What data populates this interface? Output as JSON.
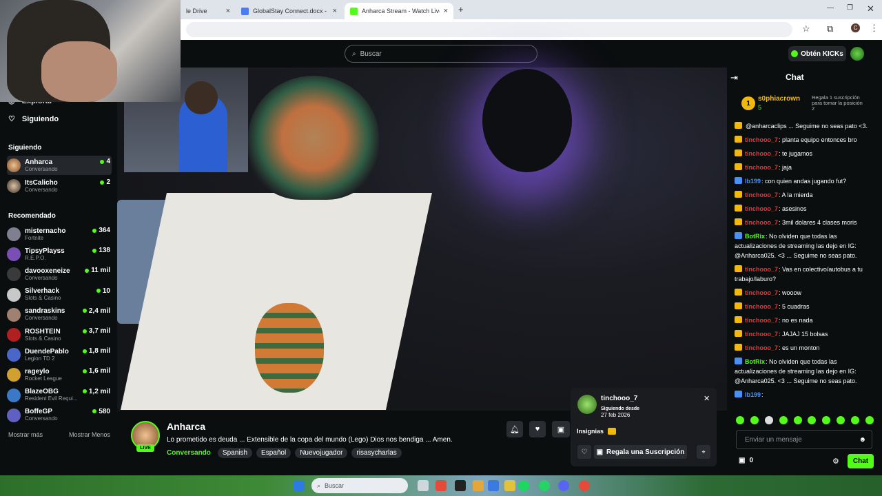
{
  "browser": {
    "tabs": [
      {
        "label": "le Drive"
      },
      {
        "label": "GlobalStay Connect.docx - Doc"
      },
      {
        "label": "Anharca Stream - Watch Live o"
      }
    ]
  },
  "kick": {
    "search_placeholder": "Buscar",
    "get_kicks": "Obtén KICKs"
  },
  "sidebar": {
    "nav": [
      {
        "label": "Explorar"
      },
      {
        "label": "Siguiendo"
      }
    ],
    "following_title": "Siguiendo",
    "following": [
      {
        "name": "Anharca",
        "sub": "Conversando",
        "viewers": "4"
      },
      {
        "name": "ItsCalicho",
        "sub": "Conversando",
        "viewers": "2"
      }
    ],
    "recommended_title": "Recomendado",
    "recommended": [
      {
        "name": "misternacho",
        "sub": "Fortnite",
        "viewers": "364"
      },
      {
        "name": "TipsyPlayss",
        "sub": "R.E.P.O.",
        "viewers": "138"
      },
      {
        "name": "davooxeneize",
        "sub": "Conversando",
        "viewers": "11 mil"
      },
      {
        "name": "Silverhack",
        "sub": "Slots & Casino",
        "viewers": "10"
      },
      {
        "name": "sandraskins",
        "sub": "Conversando",
        "viewers": "2,4 mil"
      },
      {
        "name": "ROSHTEIN",
        "sub": "Slots & Casino",
        "viewers": "3,7 mil"
      },
      {
        "name": "DuendePablo",
        "sub": "Legion TD 2",
        "viewers": "1,8 mil"
      },
      {
        "name": "rageylo",
        "sub": "Rocket League",
        "viewers": "1,6 mil"
      },
      {
        "name": "BlazeOBG",
        "sub": "Resident Evil Requi...",
        "viewers": "1,2 mil"
      },
      {
        "name": "BoffeGP",
        "sub": "Conversando",
        "viewers": "580"
      }
    ],
    "show_more": "Mostrar más",
    "show_less": "Mostrar Menos"
  },
  "stream": {
    "name": "Anharca",
    "live": "LIVE",
    "title": "Lo prometido es deuda ... Extensible de la copa del mundo (Lego) Dios nos bendiga ... Amen.",
    "category": "Conversando",
    "tags": [
      "Spanish",
      "Español",
      "Nuevojugador",
      "risasycharlas"
    ]
  },
  "popup": {
    "username": "tinchooo_7",
    "since_label": "Siguiendo desde",
    "since_date": "27 feb 2026",
    "badges_label": "Insignias",
    "gift_sub": "Regala una Suscripción"
  },
  "chat": {
    "title": "Chat",
    "pinned": {
      "rank": "1",
      "name": "s0phiacrown",
      "count": "5",
      "gift_text": "Regala 1 suscripción para tomar la posición 2"
    },
    "messages": [
      {
        "user": "",
        "text": "@anharcaclips ... Seguime no seas pato <3.",
        "color": "#ffffff",
        "badge": "#f2b90b"
      },
      {
        "user": "tinchooo_7",
        "text": ": planta equipo entonces bro",
        "color": "#e03a3a",
        "badge": "#f2b90b"
      },
      {
        "user": "tinchooo_7",
        "text": ": te jugamos",
        "color": "#e03a3a",
        "badge": "#f2b90b"
      },
      {
        "user": "tinchooo_7",
        "text": ": jaja",
        "color": "#e03a3a",
        "badge": "#f2b90b"
      },
      {
        "user": "lb199",
        "text": ": con quien andas jugando fut?",
        "color": "#4a90f2",
        "badge": "#4a90f2"
      },
      {
        "user": "tinchooo_7",
        "text": ": A la mierda",
        "color": "#e03a3a",
        "badge": "#f2b90b"
      },
      {
        "user": "tinchooo_7",
        "text": ": asesinos",
        "color": "#e03a3a",
        "badge": "#f2b90b"
      },
      {
        "user": "tinchooo_7",
        "text": ": 3mil dolares 4 clases moris",
        "color": "#e03a3a",
        "badge": "#f2b90b"
      },
      {
        "user": "BotRix",
        "text": ": No olviden que todas las actualizaciones de streaming las dejo en IG: @Anharca025. <3 ... Seguime no seas pato.",
        "color": "#53fc18",
        "badge": "#4a90f2"
      },
      {
        "user": "tinchooo_7",
        "text": ": Vas en colectivo/autobus a tu trabajo/laburo?",
        "color": "#e03a3a",
        "badge": "#f2b90b"
      },
      {
        "user": "tinchooo_7",
        "text": ": wooow",
        "color": "#e03a3a",
        "badge": "#f2b90b"
      },
      {
        "user": "tinchooo_7",
        "text": ": 5 cuadras",
        "color": "#e03a3a",
        "badge": "#f2b90b"
      },
      {
        "user": "tinchooo_7",
        "text": ": no es nada",
        "color": "#e03a3a",
        "badge": "#f2b90b"
      },
      {
        "user": "tinchooo_7",
        "text": ": JAJAJ 15 bolsas",
        "color": "#e03a3a",
        "badge": "#f2b90b"
      },
      {
        "user": "tinchooo_7",
        "text": ": es un monton",
        "color": "#e03a3a",
        "badge": "#f2b90b"
      },
      {
        "user": "BotRix",
        "text": ": No olviden que todas las actualizaciones de streaming las dejo en IG: @Anharca025. <3 ... Seguime no seas pato.",
        "color": "#53fc18",
        "badge": "#4a90f2"
      },
      {
        "user": "lb199",
        "text": ":",
        "color": "#4a90f2",
        "badge": "#4a90f2"
      }
    ],
    "input_placeholder": "Enviar un mensaje",
    "points": "0",
    "send": "Chat"
  },
  "taskbar": {
    "search": "Buscar"
  }
}
